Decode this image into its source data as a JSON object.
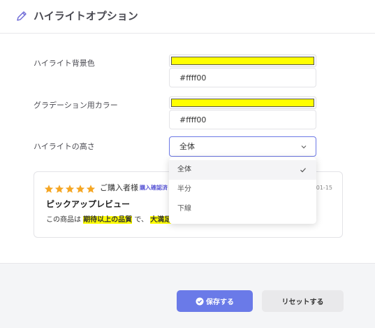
{
  "header": {
    "title": "ハイライトオプション",
    "icon": "pencil-icon"
  },
  "fields": {
    "bg_label": "ハイライト背景色",
    "bg_color": "#ffff00",
    "bg_value": "#ffff00",
    "grad_label": "グラデーション用カラー",
    "grad_color": "#ffff00",
    "grad_value": "#ffff00",
    "height_label": "ハイライトの高さ",
    "height_value": "全体"
  },
  "dropdown": {
    "options": [
      {
        "label": "全体",
        "selected": true
      },
      {
        "label": "半分",
        "selected": false
      },
      {
        "label": "下線",
        "selected": false
      }
    ]
  },
  "preview": {
    "rating": 5,
    "buyer": "ご購入者様",
    "verified": "購入確認済",
    "date": "01-15",
    "title": "ピックアップレビュー",
    "body_prefix": "この商品は",
    "highlight_1": "期待以上の品質",
    "body_mid": "で、",
    "highlight_2": "大満足"
  },
  "buttons": {
    "save": "保存する",
    "reset": "リセットする"
  },
  "colors": {
    "accent": "#6a7ae8",
    "star": "#f5a623",
    "highlight": "#ffff00"
  }
}
